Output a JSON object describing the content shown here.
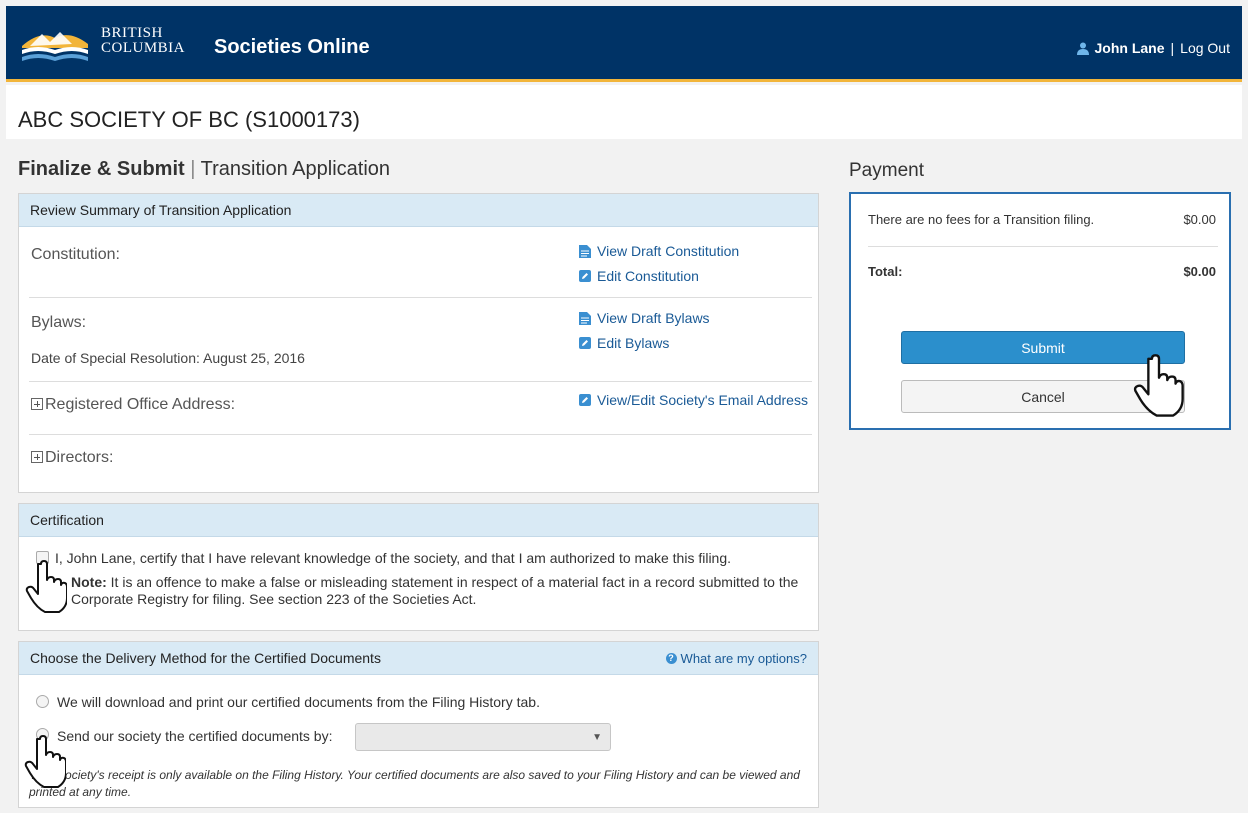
{
  "header": {
    "logo_line1": "BRITISH",
    "logo_line2": "COLUMBIA",
    "app_title": "Societies Online",
    "user_name": "John Lane",
    "separator": "|",
    "logout_label": "Log Out"
  },
  "society": {
    "name": "ABC SOCIETY OF BC (S1000173)"
  },
  "page": {
    "title_bold": "Finalize & Submit",
    "title_sep": "|",
    "title_rest": "Transition Application"
  },
  "review": {
    "heading": "Review Summary of Transition Application",
    "constitution_label": "Constitution:",
    "view_constitution": "View Draft Constitution",
    "edit_constitution": "Edit Constitution",
    "bylaws_label": "Bylaws:",
    "resolution_date": "Date of Special Resolution: August 25, 2016",
    "view_bylaws": "View Draft Bylaws",
    "edit_bylaws": "Edit Bylaws",
    "registered_office_label": "Registered Office Address:",
    "email_link": "View/Edit Society's Email Address",
    "directors_label": "Directors:"
  },
  "certification": {
    "heading": "Certification",
    "statement": "I, John Lane, certify that I have relevant knowledge of the society, and that I am authorized to make this filing.",
    "note_label": "Note:",
    "note_text": " It is an offence to make a false or misleading statement in respect of a material fact in a record submitted to the Corporate Registry for filing. See section 223 of the Societies Act."
  },
  "delivery": {
    "heading": "Choose the Delivery Method for the Certified Documents",
    "help_link": "What are my options?",
    "option_download": "We will download and print our certified documents from the Filing History tab.",
    "option_send": "Send our society the certified documents by:",
    "send_method_value": "",
    "receipt_note": "Your Society's receipt is only available on the Filing History. Your certified documents are also saved to your Filing History and can be viewed and printed at any time."
  },
  "payment": {
    "heading": "Payment",
    "fee_description": "There are no fees for a Transition filing.",
    "fee_amount": "$0.00",
    "total_label": "Total:",
    "total_amount": "$0.00",
    "submit_label": "Submit",
    "cancel_label": "Cancel"
  },
  "colors": {
    "header_bg": "#003366",
    "header_accent": "#f2b53a",
    "panel_head_bg": "#d9eaf5",
    "link": "#1a5a96",
    "submit_bg": "#2b8fcc",
    "payment_border": "#2a6fb0"
  }
}
